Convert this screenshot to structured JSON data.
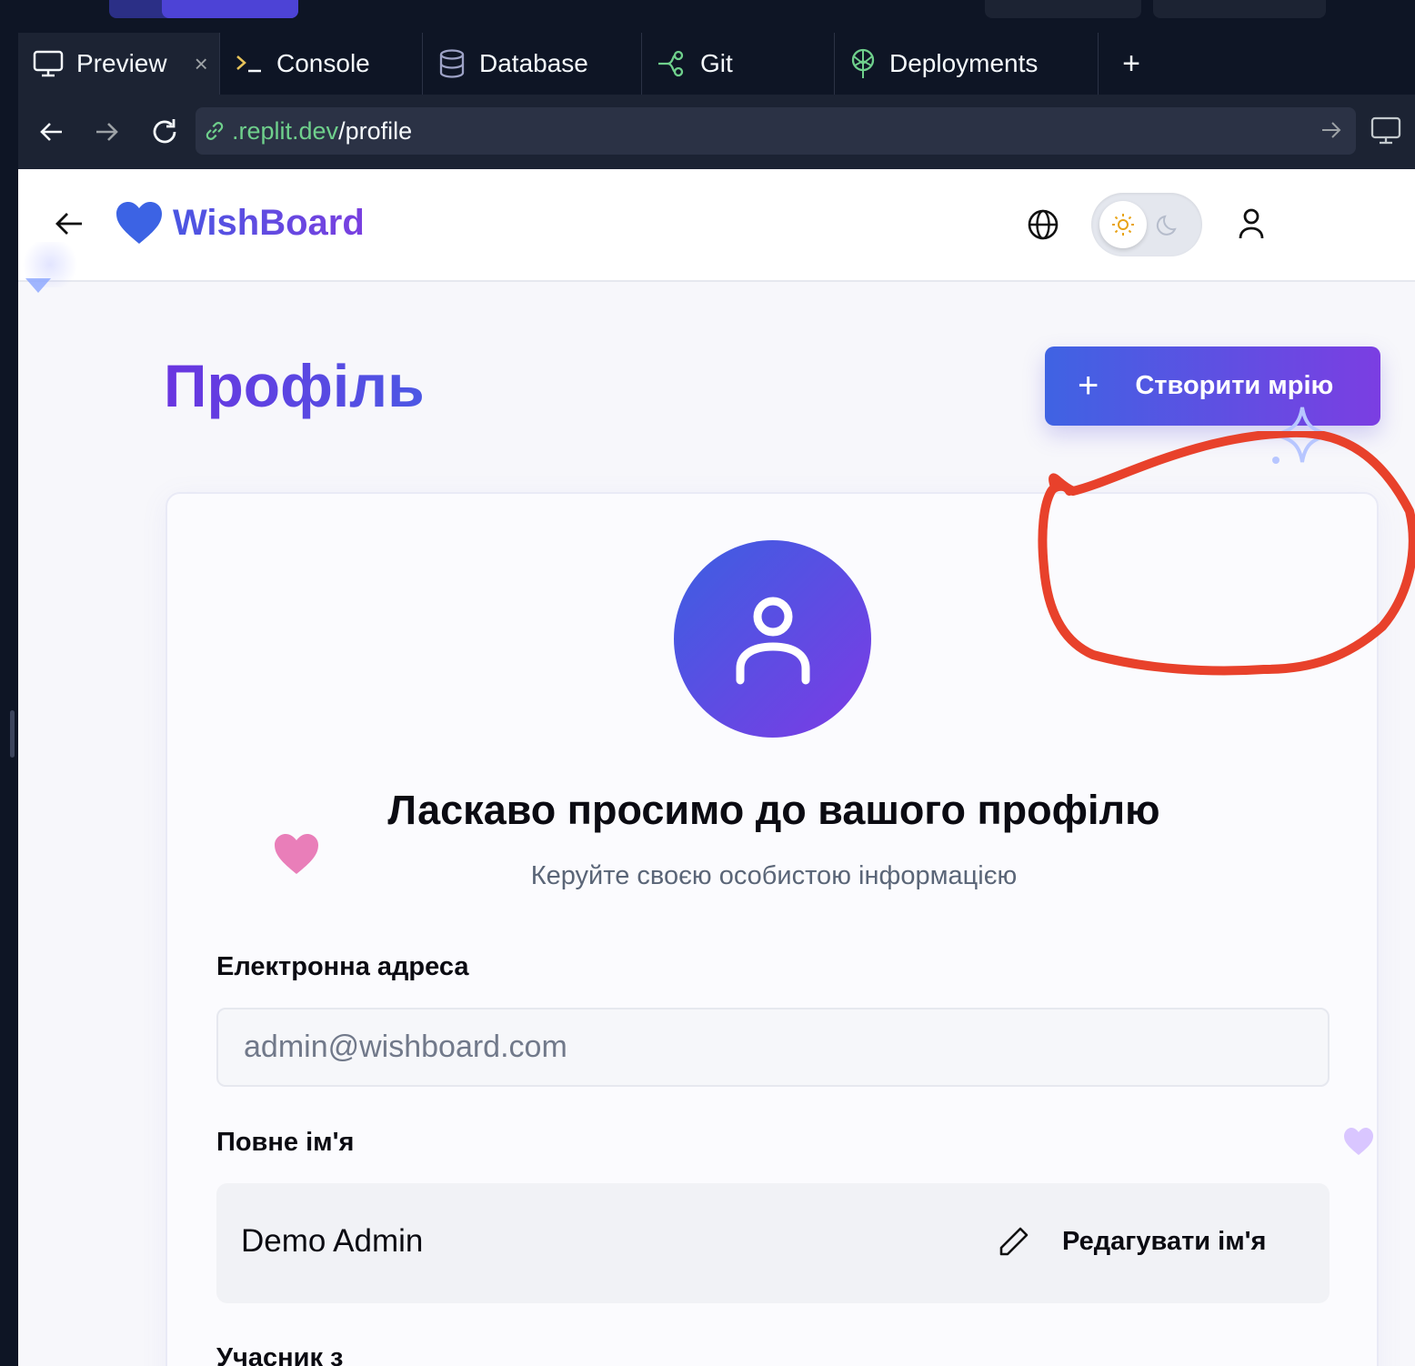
{
  "ide": {
    "tabs": [
      {
        "label": "Preview",
        "icon": "monitor-icon",
        "active": true,
        "close": "×"
      },
      {
        "label": "Console",
        "icon": "terminal-icon"
      },
      {
        "label": "Database",
        "icon": "database-icon"
      },
      {
        "label": "Git",
        "icon": "git-icon"
      },
      {
        "label": "Deployments",
        "icon": "deployments-icon"
      }
    ],
    "add_tab": "+",
    "address": {
      "host": ".replit.dev",
      "path": "/profile"
    }
  },
  "app": {
    "brand": "WishBoard",
    "page_title": "Профіль",
    "create_button": {
      "icon": "+",
      "label": "Створити мрію"
    },
    "welcome": "Ласкаво просимо до вашого профілю",
    "subtitle": "Керуйте своєю особистою інформацією",
    "email": {
      "label": "Електронна адреса",
      "value": "admin@wishboard.com"
    },
    "full_name": {
      "label": "Повне ім'я",
      "value": "Demo Admin",
      "edit_label": "Редагувати ім'я"
    },
    "member_since": {
      "label": "Учасник з"
    },
    "theme": "light"
  },
  "colors": {
    "accent_start": "#3f63e3",
    "accent_end": "#7b3ee2",
    "annotation": "#e8412b",
    "ide_bg": "#0e1525"
  }
}
